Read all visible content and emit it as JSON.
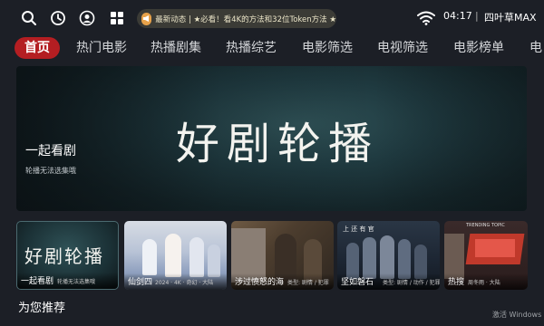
{
  "topbar": {
    "icons": [
      "search-icon",
      "history-icon",
      "user-icon",
      "grid-icon"
    ],
    "notice": "最新动态 | ★必看！看4K的方法和32位Token方法 ★",
    "time": "04:17",
    "separator": "|",
    "brand": "四叶草MAX"
  },
  "nav": {
    "items": [
      "首页",
      "热门电影",
      "热播剧集",
      "热播综艺",
      "电影筛选",
      "电视筛选",
      "电影榜单",
      "电"
    ],
    "active_index": 0
  },
  "banner": {
    "big_text": "好剧轮播",
    "title": "一起看剧",
    "subtitle": "轮播无法选集哦"
  },
  "thumbnails": [
    {
      "big": "好剧轮播",
      "title": "一起看剧",
      "sub": "轮播无法选集哦"
    },
    {
      "title": "仙剑四",
      "sub": "2024 · 4K · 奇幻 · 大陆"
    },
    {
      "title": "涉过愤怒的海",
      "sub": "类型: 剧情 / 犯罪"
    },
    {
      "title": "坚如磐石",
      "sub": "类型: 剧情 / 动作 / 犯罪",
      "poster_text": "上 还 有 官"
    },
    {
      "title": "热搜",
      "sub": "周冬雨 · 大陆",
      "poster_text": "TRENDING TOPIC"
    }
  ],
  "section_title": "为您推荐",
  "watermark": "激活 Windows"
}
